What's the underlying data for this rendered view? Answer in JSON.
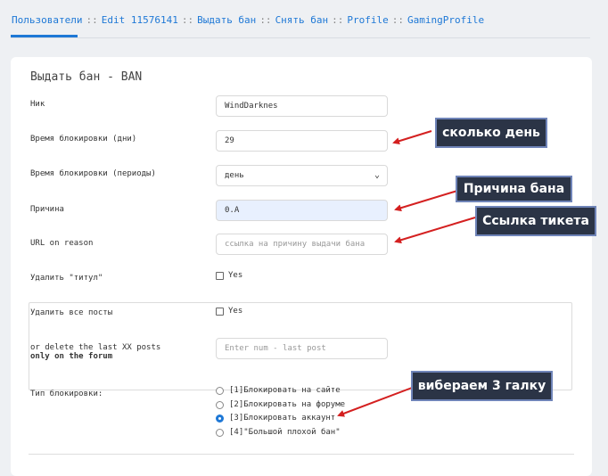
{
  "breadcrumb": {
    "separator": "::",
    "items": [
      "Пользователи",
      "Edit 11576141",
      "Выдать бан",
      "Снять бан",
      "Profile",
      "GamingProfile"
    ]
  },
  "form": {
    "title": "Выдать бан - BAN",
    "nick": {
      "label": "Ник",
      "value": "WindDarknes"
    },
    "ban_days": {
      "label": "Время блокировки (дни)",
      "value": "29"
    },
    "ban_period": {
      "label": "Время блокировки (периоды)",
      "value": "день"
    },
    "reason": {
      "label": "Причина",
      "value": "0.A"
    },
    "url_reason": {
      "label": "URL on reason",
      "placeholder": "ссылка на причину выдачи бана"
    },
    "remove_title": {
      "label": "Удалить \"титул\"",
      "option": "Yes"
    },
    "delete_posts": {
      "label": "Удалить все посты",
      "option": "Yes"
    },
    "delete_last": {
      "label_line1": "or delete the last XX posts",
      "label_line2": "only on the forum",
      "placeholder": "Enter num -  last post"
    },
    "block_type": {
      "label": "Тип блокировки:",
      "options": [
        "[1]Блокировать на сайте",
        "[2]Блокировать на форуме",
        "[3]Блокировать аккаунт",
        "[4]\"Большой плохой бан\""
      ],
      "selected_index": 2
    }
  },
  "annotations": {
    "days": "сколько день",
    "reason": "Причина бана",
    "ticket": "Ссылка тикета",
    "third": "вибераем 3 галку"
  },
  "colors": {
    "link": "#1e78d6",
    "annotation_bg": "#2b3446",
    "arrow": "#d42020"
  }
}
